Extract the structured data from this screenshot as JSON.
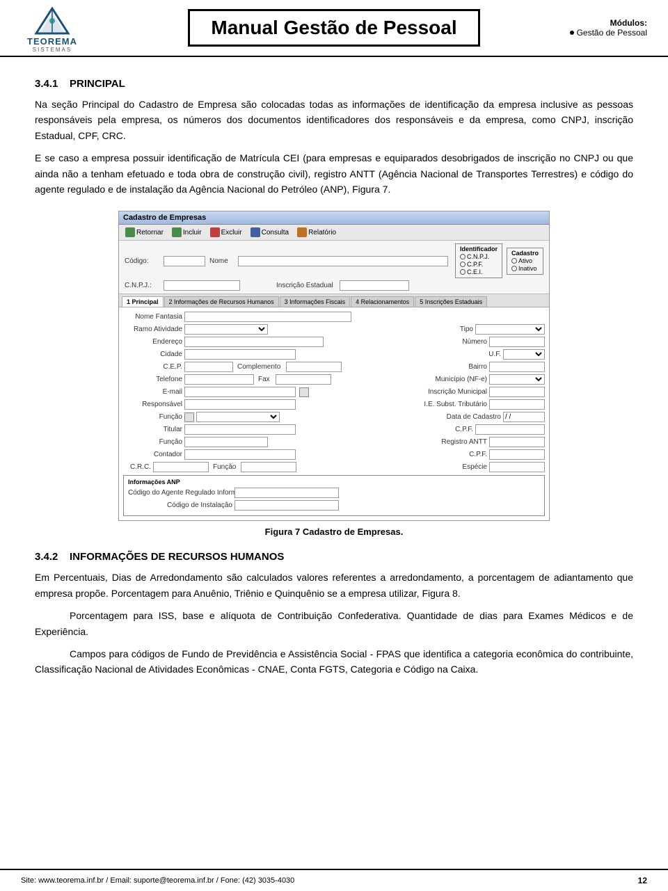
{
  "header": {
    "logo_text_1": "TEOREMA",
    "logo_text_2": "SISTEMAS",
    "title": "Manual Gestão de Pessoal",
    "modules_label": "Módulos:",
    "module_item": "Gestão de Pessoal"
  },
  "section1": {
    "number": "3.4.1",
    "title": "PRINCIPAL",
    "body1": "Na seção Principal do Cadastro de Empresa são colocadas todas as informações de identificação da empresa inclusive as pessoas responsáveis pela empresa, os números dos documentos identificadores dos responsáveis e da empresa, como CNPJ, inscrição Estadual, CPF, CRC.",
    "body2": "E se caso a empresa possuir identificação de Matrícula CEI (para empresas e equiparados desobrigados de inscrição no CNPJ ou que ainda não a tenham efetuado e toda obra de construção civil), registro ANTT (Agência Nacional de Transportes Terrestres) e código do agente regulado e de instalação da Agência Nacional do Petróleo (ANP), Figura 7."
  },
  "figure": {
    "caption": "Figura 7 Cadastro de Empresas.",
    "window_title": "Cadastro de Empresas",
    "toolbar": {
      "btn1": "Retornar",
      "btn2": "Incluir",
      "btn3": "Excluir",
      "btn4": "Consulta",
      "btn5": "Relatório"
    },
    "fields": {
      "codigo_label": "Código:",
      "nome_label": "Nome",
      "cnpj_label": "C.N.P.J.:",
      "insc_estadual_label": "Inscrição Estadual"
    },
    "identificador_group": "Identificador",
    "radio1": "C.N.P.J.",
    "radio2": "C.P.F.",
    "radio3": "C.E.I.",
    "cadastro_group": "Cadastro",
    "radio4": "Ativo",
    "radio5": "Inativo",
    "tabs": [
      "1 Principal",
      "2 Informações de Recursos Humanos",
      "3 Informações Fiscais",
      "4 Relacionamentos",
      "5 Inscrições Estaduais"
    ],
    "form_fields": {
      "nome_fantasia": "Nome Fantasia",
      "ramo_atividade": "Ramo Atividade",
      "tipo": "Tipo",
      "endereco": "Endereço",
      "numero": "Número",
      "cidade": "Cidade",
      "uf": "U.F.",
      "cep": "C.E.P.",
      "complemento": "Complemento",
      "bairro": "Bairro",
      "telefone": "Telefone",
      "fax": "Fax",
      "municipio": "Município (NF-e)",
      "email": "E-mail",
      "insc_municipal": "Inscrição Municipal",
      "responsavel": "Responsável",
      "ie_subst": "I.E. Subst. Tributário",
      "funcao": "Função",
      "data_cadastro": "Data de Cadastro",
      "data_val": "/ /",
      "titular": "Titular",
      "cpf": "C.P.F.",
      "funcao2": "Função",
      "registro_antt": "Registro ANTT",
      "contador": "Contador",
      "cpf2": "C.P.F.",
      "crc": "C.R.C.",
      "funcao3": "Função",
      "especie": "Espécie",
      "anp_group_title": "Informações ANP",
      "codigo_agente": "Código do Agente Regulado Informante",
      "codigo_instalacao": "Código de Instalação"
    }
  },
  "section2": {
    "number": "3.4.2",
    "title": "INFORMAÇÕES DE RECURSOS HUMANOS",
    "body1": "Em Percentuais, Dias de Arredondamento são calculados valores referentes a arredondamento, a porcentagem de adiantamento que empresa propõe. Porcentagem para Anuênio, Triênio e Quinquênio se a empresa utilizar, Figura 8.",
    "body2": "Porcentagem para ISS, base e alíquota de Contribuição Confederativa. Quantidade de dias para Exames Médicos e de Experiência.",
    "body3": "Campos para códigos de Fundo de Previdência e Assistência Social - FPAS que identifica a categoria econômica do contribuinte, Classificação Nacional de Atividades Econômicas - CNAE, Conta FGTS, Categoria e Código na Caixa."
  },
  "footer": {
    "text": "Site: www.teorema.inf.br / Email: suporte@teorema.inf.br / Fone: (42) 3035-4030",
    "page": "12"
  }
}
